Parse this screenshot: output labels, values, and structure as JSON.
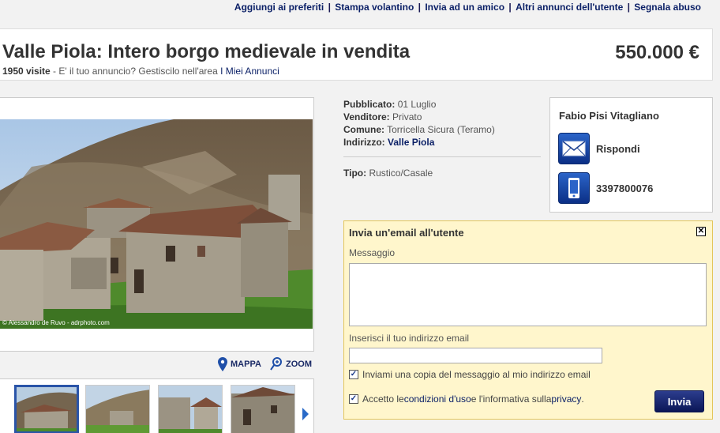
{
  "toplinks": {
    "favorites": "Aggiungi ai preferiti",
    "print": "Stampa volantino",
    "send_friend": "Invia ad un amico",
    "other_ads": "Altri annunci dell'utente",
    "report": "Segnala abuso"
  },
  "listing": {
    "title": "Valle Piola: Intero borgo medievale in vendita",
    "price": "550.000 €",
    "visits": "1950 visite",
    "manage_prompt": " - E' il tuo annuncio? Gestiscilo nell'area ",
    "manage_link": "I Miei Annunci"
  },
  "photo": {
    "credit": "© Alessandro de Ruvo - adrphoto.com"
  },
  "tools": {
    "map": "MAPPA",
    "zoom": "ZOOM"
  },
  "details": {
    "published_label": "Pubblicato:",
    "published_value": "01 Luglio",
    "seller_label": "Venditore:",
    "seller_value": "Privato",
    "town_label": "Comune:",
    "town_value": "Torricella Sicura (Teramo)",
    "address_label": "Indirizzo:",
    "address_value": "Valle Piola",
    "type_label": "Tipo:",
    "type_value": "Rustico/Casale"
  },
  "seller": {
    "name": "Fabio Pisi Vitagliano",
    "reply": "Rispondi",
    "phone": "3397800076"
  },
  "email_form": {
    "title": "Invia un'email all'utente",
    "close": "✕",
    "message_label": "Messaggio",
    "email_label": "Inserisci il tuo indirizzo email",
    "copy_label": "Inviami una copia del messaggio al mio indirizzo email",
    "accept_prefix": "Accetto le ",
    "terms_link": "condizioni d'uso",
    "accept_mid": " e l'informativa sulla ",
    "privacy_link": "privacy",
    "accept_suffix": ".",
    "copy_checked": true,
    "accept_checked": true,
    "send": "Invia"
  },
  "colors": {
    "brand_navy": "#0a1f66",
    "form_bg": "#fff6cc",
    "form_border": "#e3c65a",
    "icon_blue": "#2b64c8"
  }
}
